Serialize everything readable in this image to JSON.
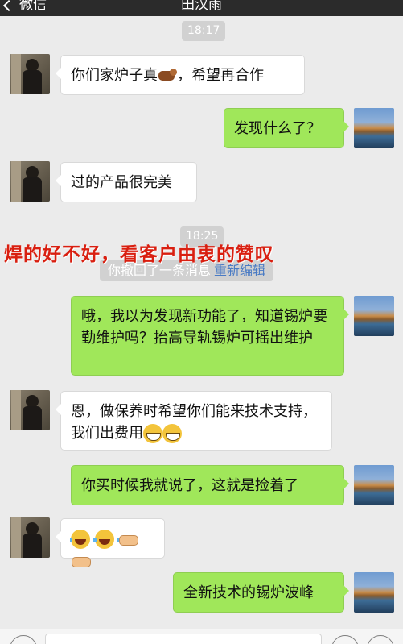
{
  "header": {
    "back_label": "微信",
    "contact_name": "田汉雨"
  },
  "messages": [
    {
      "type": "time",
      "text": "18:17"
    },
    {
      "type": "text",
      "side": "left",
      "text": "你们家炉子真",
      "emoji": "cow-emoji",
      "tail": "，希望再合作"
    },
    {
      "type": "text",
      "side": "right",
      "text": "发现什么了？"
    },
    {
      "type": "text",
      "side": "left",
      "text": "过的产品很完美"
    },
    {
      "type": "time",
      "text": "18:25"
    },
    {
      "type": "recall",
      "text": "你撤回了一条消息",
      "action": "重新编辑"
    },
    {
      "type": "text",
      "side": "right",
      "text": "哦，我以为发现新功能了，知道锡炉要勤维护吗？抬高导轨锡炉可摇出维护"
    },
    {
      "type": "text",
      "side": "left",
      "text": "恩，做保养时希望你们能来技术支持，我们出费用",
      "emoji": "grin-emoji x2"
    },
    {
      "type": "text",
      "side": "right",
      "text": "你买时候我就说了，这就是捡着了"
    },
    {
      "type": "emoji-only",
      "side": "left",
      "emoji": "tears-of-joy-emoji x2, handshake-emoji x2"
    },
    {
      "type": "text",
      "side": "right",
      "text": "全新技术的锡炉波峰"
    }
  ],
  "overlay_caption": "焊的好不好，看客户由衷的赞叹",
  "colors": {
    "self_bubble": "#a0e75a",
    "other_bubble": "#ffffff",
    "background": "#ebebeb",
    "caption": "#d91f10",
    "reedit_link": "#4a7bc4"
  }
}
